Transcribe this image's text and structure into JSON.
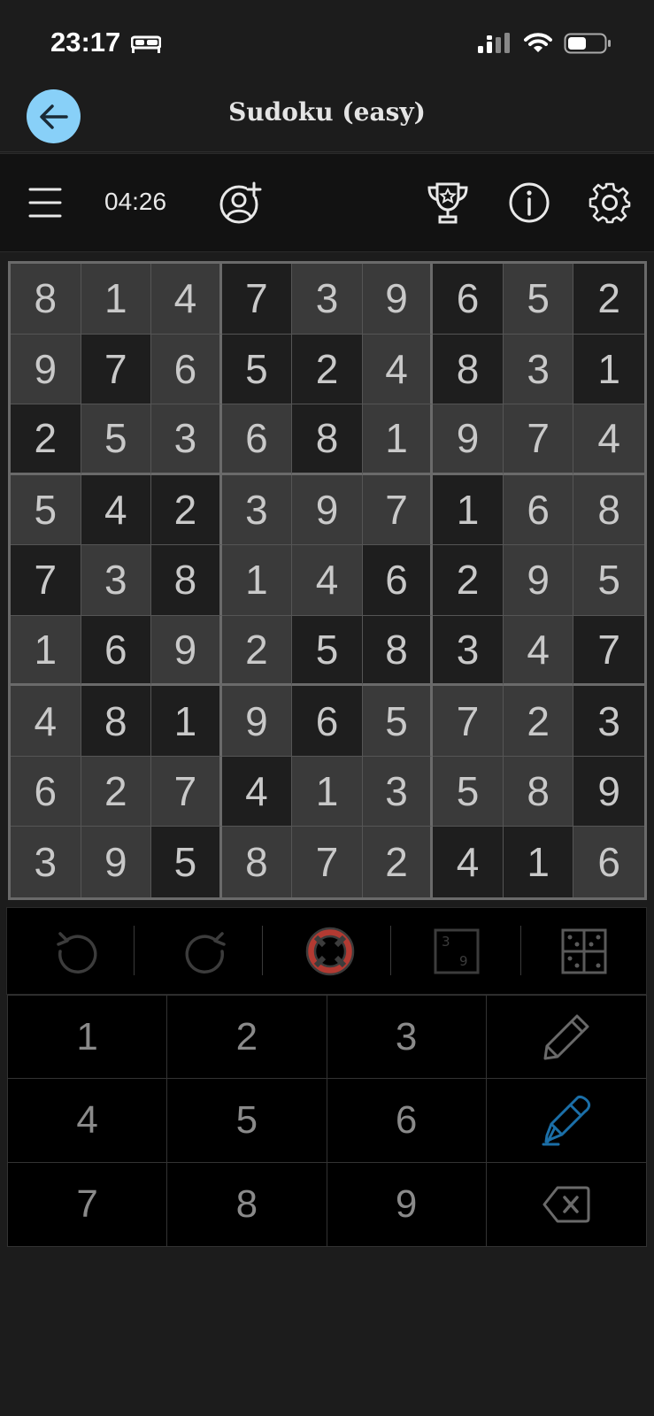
{
  "status_bar": {
    "time": "23:17"
  },
  "header": {
    "title": "Sudoku (easy)"
  },
  "toolbar": {
    "timer": "04:26"
  },
  "grid": {
    "values": [
      [
        8,
        1,
        4,
        7,
        3,
        9,
        6,
        5,
        2
      ],
      [
        9,
        7,
        6,
        5,
        2,
        4,
        8,
        3,
        1
      ],
      [
        2,
        5,
        3,
        6,
        8,
        1,
        9,
        7,
        4
      ],
      [
        5,
        4,
        2,
        3,
        9,
        7,
        1,
        6,
        8
      ],
      [
        7,
        3,
        8,
        1,
        4,
        6,
        2,
        9,
        5
      ],
      [
        1,
        6,
        9,
        2,
        5,
        8,
        3,
        4,
        7
      ],
      [
        4,
        8,
        1,
        9,
        6,
        5,
        7,
        2,
        3
      ],
      [
        6,
        2,
        7,
        4,
        1,
        3,
        5,
        8,
        9
      ],
      [
        3,
        9,
        5,
        8,
        7,
        2,
        4,
        1,
        6
      ]
    ],
    "shades": [
      "LLLDLLDLD",
      "LDLDDLDLD",
      "DLLLDLLLL",
      "LDDLLLDLL",
      "DLDLLDDLL",
      "LDLLDDDLD",
      "LDDLDLLLD",
      "LLLDLLLLD",
      "LLDLLLDDL"
    ]
  },
  "keypad": {
    "keys": [
      "1",
      "2",
      "3",
      "4",
      "5",
      "6",
      "7",
      "8",
      "9"
    ]
  },
  "colors": {
    "accent": "#88d0f8",
    "pen_active": "#1b6fa8",
    "cell_light": "#3a3a3a",
    "cell_dark": "#1e1e1e",
    "hint_red": "#b23a32"
  }
}
